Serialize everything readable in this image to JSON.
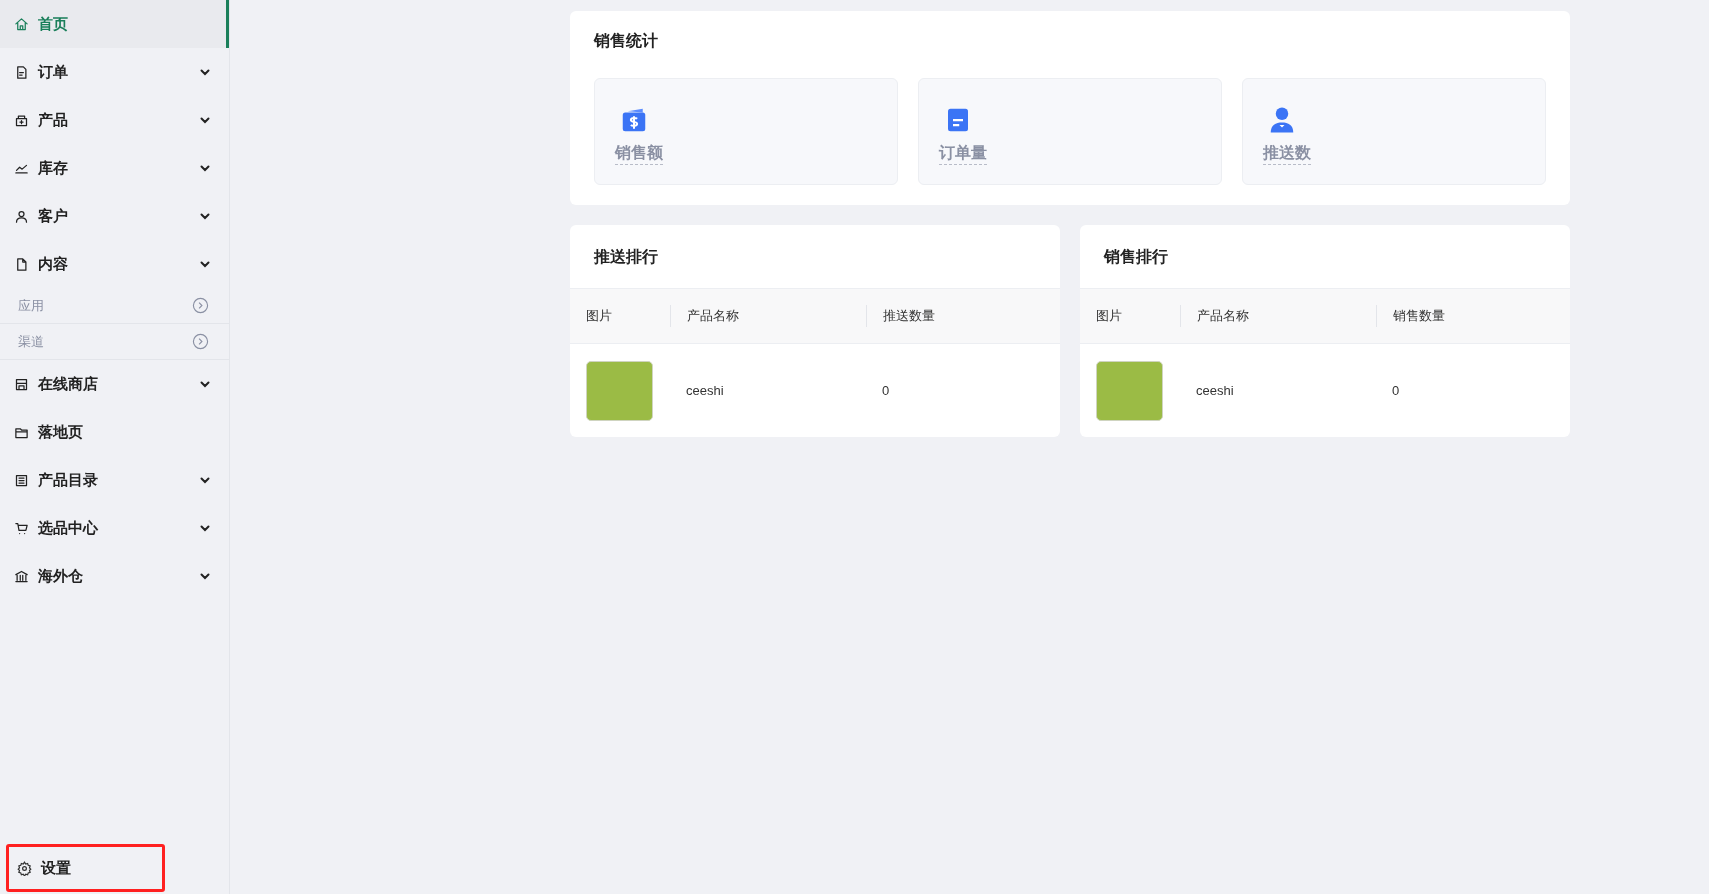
{
  "sidebar": {
    "items": [
      {
        "label": "首页",
        "kind": "menu",
        "selected": true,
        "expandable": false
      },
      {
        "label": "订单",
        "kind": "menu",
        "selected": false,
        "expandable": true
      },
      {
        "label": "产品",
        "kind": "menu",
        "selected": false,
        "expandable": true
      },
      {
        "label": "库存",
        "kind": "menu",
        "selected": false,
        "expandable": true
      },
      {
        "label": "客户",
        "kind": "menu",
        "selected": false,
        "expandable": true
      },
      {
        "label": "内容",
        "kind": "menu",
        "selected": false,
        "expandable": true
      },
      {
        "label": "应用",
        "kind": "sub",
        "selected": false
      },
      {
        "label": "渠道",
        "kind": "sub",
        "selected": false
      },
      {
        "label": "在线商店",
        "kind": "menu",
        "selected": false,
        "expandable": true
      },
      {
        "label": "落地页",
        "kind": "menu",
        "selected": false,
        "expandable": false
      },
      {
        "label": "产品目录",
        "kind": "menu",
        "selected": false,
        "expandable": true
      },
      {
        "label": "选品中心",
        "kind": "menu",
        "selected": false,
        "expandable": true
      },
      {
        "label": "海外仓",
        "kind": "menu",
        "selected": false,
        "expandable": true
      }
    ],
    "settings": {
      "label": "设置",
      "highlighted": true
    }
  },
  "sales_stats": {
    "title": "销售统计",
    "cards": [
      {
        "label": "销售额"
      },
      {
        "label": "订单量"
      },
      {
        "label": "推送数"
      }
    ]
  },
  "rankings": [
    {
      "title": "推送排行",
      "columns": [
        "图片",
        "产品名称",
        "推送数量"
      ],
      "rows": [
        {
          "name": "ceeshi",
          "count": "0"
        }
      ]
    },
    {
      "title": "销售排行",
      "columns": [
        "图片",
        "产品名称",
        "销售数量"
      ],
      "rows": [
        {
          "name": "ceeshi",
          "count": "0"
        }
      ]
    }
  ]
}
